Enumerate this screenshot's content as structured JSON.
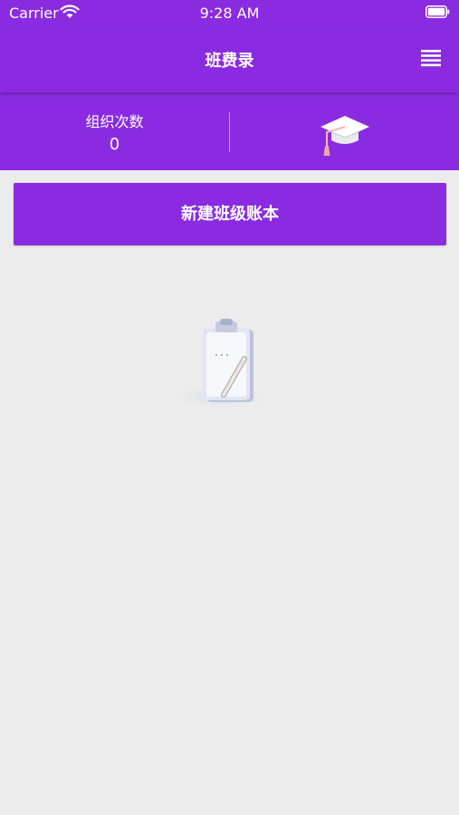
{
  "status_bar": {
    "carrier": "Carrier",
    "time": "9:28 AM",
    "wifi_icon": "wifi-icon",
    "battery_icon": "battery-icon"
  },
  "nav": {
    "title": "班费录",
    "menu_icon": "hamburger-menu-icon"
  },
  "stats": {
    "label": "组织次数",
    "value": "0",
    "icon": "graduation-cap-icon"
  },
  "actions": {
    "create_label": "新建班级账本"
  },
  "empty_state": {
    "icon": "clipboard-pencil-icon"
  },
  "colors": {
    "primary": "#8a2be2",
    "background": "#ececec",
    "text_on_primary": "#ffffff"
  }
}
